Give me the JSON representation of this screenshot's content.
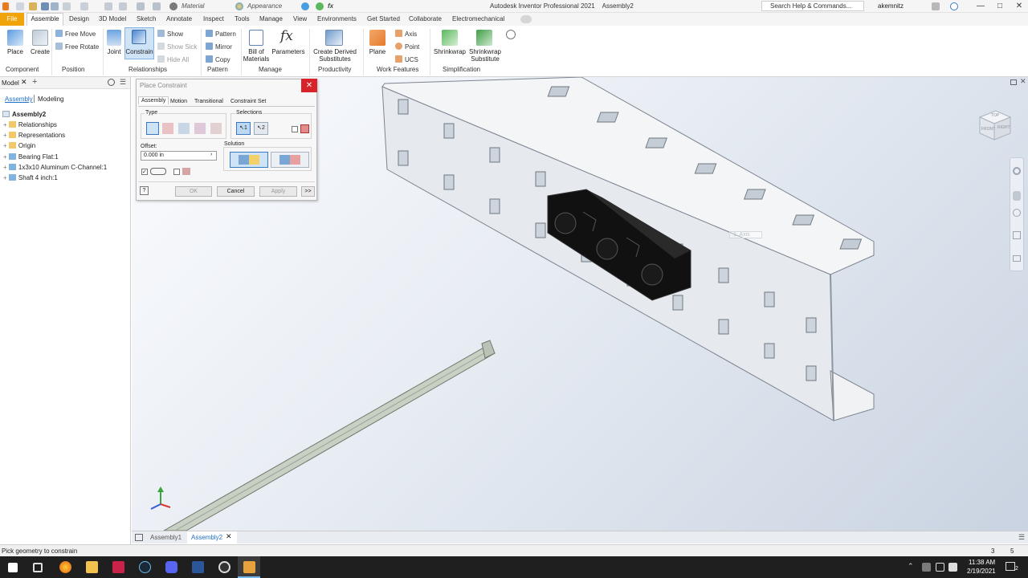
{
  "quick_access": {
    "material": "Material",
    "appearance": "Appearance"
  },
  "window": {
    "title": "Autodesk Inventor Professional 2021",
    "document": "Assembly2",
    "search_placeholder": "Search Help & Commands...",
    "user": "akemnitz"
  },
  "tabs": [
    "File",
    "Assemble",
    "Design",
    "3D Model",
    "Sketch",
    "Annotate",
    "Inspect",
    "Tools",
    "Manage",
    "View",
    "Environments",
    "Get Started",
    "Collaborate",
    "Electromechanical"
  ],
  "ribbon": {
    "component": {
      "place": "Place",
      "create": "Create",
      "group": "Component"
    },
    "position": {
      "free_move": "Free Move",
      "free_rotate": "Free Rotate",
      "group": "Position"
    },
    "relationships": {
      "joint": "Joint",
      "constrain": "Constrain",
      "show": "Show",
      "show_sick": "Show Sick",
      "hide_all": "Hide All",
      "group": "Relationships"
    },
    "pattern": {
      "pattern": "Pattern",
      "mirror": "Mirror",
      "copy": "Copy",
      "group": "Pattern"
    },
    "manage": {
      "bom_line1": "Bill of",
      "bom_line2": "Materials",
      "parameters": "Parameters",
      "group": "Manage"
    },
    "productivity": {
      "line1": "Create Derived",
      "line2": "Substitutes",
      "group": "Productivity"
    },
    "work_features": {
      "plane": "Plane",
      "axis": "Axis",
      "point": "Point",
      "ucs": "UCS",
      "group": "Work Features"
    },
    "simplification": {
      "shrinkwrap": "Shrinkwrap",
      "sub_line1": "Shrinkwrap",
      "sub_line2": "Substitute",
      "group": "Simplification"
    }
  },
  "browser": {
    "title": "Model",
    "modes": [
      "Assembly",
      "Modeling"
    ],
    "root": "Assembly2",
    "items": [
      "Relationships",
      "Representations",
      "Origin",
      "Bearing Flat:1",
      "1x3x10 Aluminum C-Channel:1",
      "Shaft 4 inch:1"
    ]
  },
  "dialog": {
    "title": "Place Constraint",
    "tabs": [
      "Assembly",
      "Motion",
      "Transitional",
      "Constraint Set"
    ],
    "type_label": "Type",
    "selections_label": "Selections",
    "offset_label": "Offset:",
    "offset_value": "0.000 in",
    "solution_label": "Solution",
    "ok": "OK",
    "cancel": "Cancel",
    "apply": "Apply",
    "more": ">>"
  },
  "viewport": {
    "axis_tooltip": "1: Axis",
    "viewcube_front": "FRONT",
    "viewcube_right": "RIGHT",
    "viewcube_top": "TOP"
  },
  "doc_tabs": [
    "Assembly1",
    "Assembly2"
  ],
  "status": {
    "text": "Pick geometry to constrain",
    "n1": "3",
    "n2": "5"
  },
  "taskbar": {
    "time": "11:38 AM",
    "date": "2/19/2021",
    "notifications": "2"
  }
}
